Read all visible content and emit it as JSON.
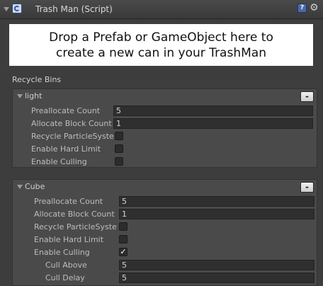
{
  "header": {
    "title": "Trash Man (Script)",
    "help_icon": "help-icon",
    "gear_icon": "gear-icon",
    "script_icon": "csharp-script-icon"
  },
  "dropzone": {
    "line1": "Drop a Prefab or GameObject here to",
    "line2": "create a new can in your TrashMan"
  },
  "section": {
    "label": "Recycle Bins"
  },
  "bins": [
    {
      "name": "light",
      "remove_label": "-",
      "fields": {
        "preallocate_label": "Preallocate Count",
        "preallocate_value": "5",
        "allocate_label": "Allocate Block Count",
        "allocate_value": "1",
        "recycle_label": "Recycle ParticleSyste",
        "hard_limit_label": "Enable Hard Limit",
        "culling_label": "Enable Culling"
      },
      "checks": {
        "recycle": false,
        "hard_limit": false,
        "culling": false
      }
    },
    {
      "name": "Cube",
      "remove_label": "-",
      "fields": {
        "preallocate_label": "Preallocate Count",
        "preallocate_value": "5",
        "allocate_label": "Allocate Block Count",
        "allocate_value": "1",
        "recycle_label": "Recycle ParticleSyste",
        "hard_limit_label": "Enable Hard Limit",
        "culling_label": "Enable Culling",
        "cull_above_label": "Cull Above",
        "cull_above_value": "5",
        "cull_delay_label": "Cull Delay",
        "cull_delay_value": "5"
      },
      "checks": {
        "recycle": false,
        "hard_limit": false,
        "culling": true
      },
      "check_mark": "✓"
    }
  ]
}
